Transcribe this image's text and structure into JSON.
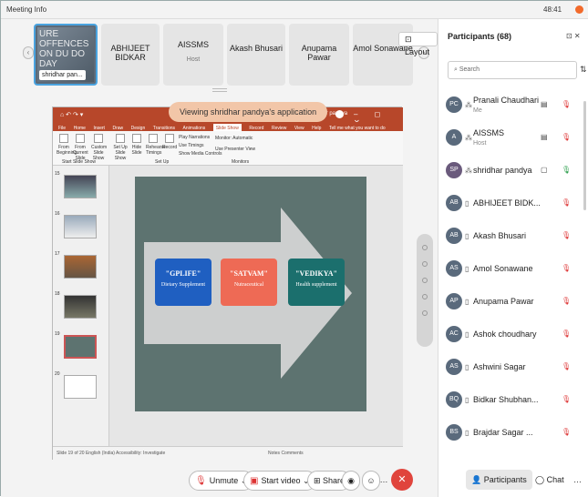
{
  "topbar": {
    "title": "Meeting Info",
    "time": "48:41"
  },
  "strip": {
    "prev_icon": "chevron-left",
    "next_icon": "chevron-right",
    "tiles": [
      {
        "name": "shridhar pan...",
        "sub": ""
      },
      {
        "name": "ABHIJEET BIDKAR",
        "sub": ""
      },
      {
        "name": "AISSMS",
        "sub": "Host"
      },
      {
        "name": "Akash Bhusari",
        "sub": ""
      },
      {
        "name": "Anupama Pawar",
        "sub": ""
      },
      {
        "name": "Amol Sonawane",
        "sub": ""
      }
    ],
    "active_tile_overlay": "URE OFFENCES ON DU DO DAY",
    "layout_label": "Layout"
  },
  "share": {
    "viewing_banner": "Viewing shridhar pandya's application",
    "ppt_user": "shridhar pandya",
    "ribbon_tabs": [
      "File",
      "Home",
      "Insert",
      "Draw",
      "Design",
      "Transitions",
      "Animations",
      "Slide Show",
      "Record",
      "Review",
      "View",
      "Help"
    ],
    "ribbon_tell": "Tell me what you want to do",
    "selected_tab": "Slide Show",
    "ribbon_buttons": [
      "From Beginning",
      "From Current Slide",
      "Custom Slide Show",
      "Set Up Slide Show",
      "Hide Slide",
      "Rehearse Timings",
      "Record"
    ],
    "ribbon_checks": [
      "Play Narrations",
      "Use Timings",
      "Show Media Controls"
    ],
    "monitor_label": "Monitor: Automatic",
    "presenter_view": "Use Presenter View",
    "ribbon_groups": [
      "Start Slide Show",
      "Set Up",
      "Monitors"
    ],
    "thumb_numbers": [
      "15",
      "16",
      "17",
      "18",
      "19",
      "20"
    ],
    "slide_boxes": [
      {
        "title": "\"GPLIFE\"",
        "subtitle": "Dietary Supplement",
        "color": "#1f5fc1"
      },
      {
        "title": "\"SATVAM\"",
        "subtitle": "Nutraceutical",
        "color": "#ee6a55"
      },
      {
        "title": "\"VEDIKYA\"",
        "subtitle": "Health supplement",
        "color": "#1b6f6d"
      }
    ],
    "status_left": "Slide 19 of 20   English (India)   Accessibility: Investigate",
    "status_right": "Notes   Comments"
  },
  "controls": {
    "unmute": "Unmute",
    "start_video": "Start video",
    "share": "Share"
  },
  "participants": {
    "header": "Participants (68)",
    "search_placeholder": "Search",
    "people": [
      {
        "initials": "PC",
        "name": "Pranali Chaudhari",
        "role": "Me"
      },
      {
        "initials": "A",
        "name": "AISSMS",
        "role": "Host"
      },
      {
        "initials": "SP",
        "name": "shridhar pandya",
        "role": ""
      },
      {
        "initials": "AB",
        "name": "ABHIJEET BIDK...",
        "role": ""
      },
      {
        "initials": "AB",
        "name": "Akash Bhusari",
        "role": ""
      },
      {
        "initials": "AS",
        "name": "Amol Sonawane",
        "role": ""
      },
      {
        "initials": "AP",
        "name": "Anupama Pawar",
        "role": ""
      },
      {
        "initials": "AC",
        "name": "Ashok choudhary",
        "role": ""
      },
      {
        "initials": "AS",
        "name": "Ashwini Sagar",
        "role": ""
      },
      {
        "initials": "BQ",
        "name": "Bidkar Shubhan...",
        "role": ""
      },
      {
        "initials": "BS",
        "name": "Brajdar Sagar ...",
        "role": ""
      }
    ],
    "footer_participants": "Participants",
    "footer_chat": "Chat"
  }
}
